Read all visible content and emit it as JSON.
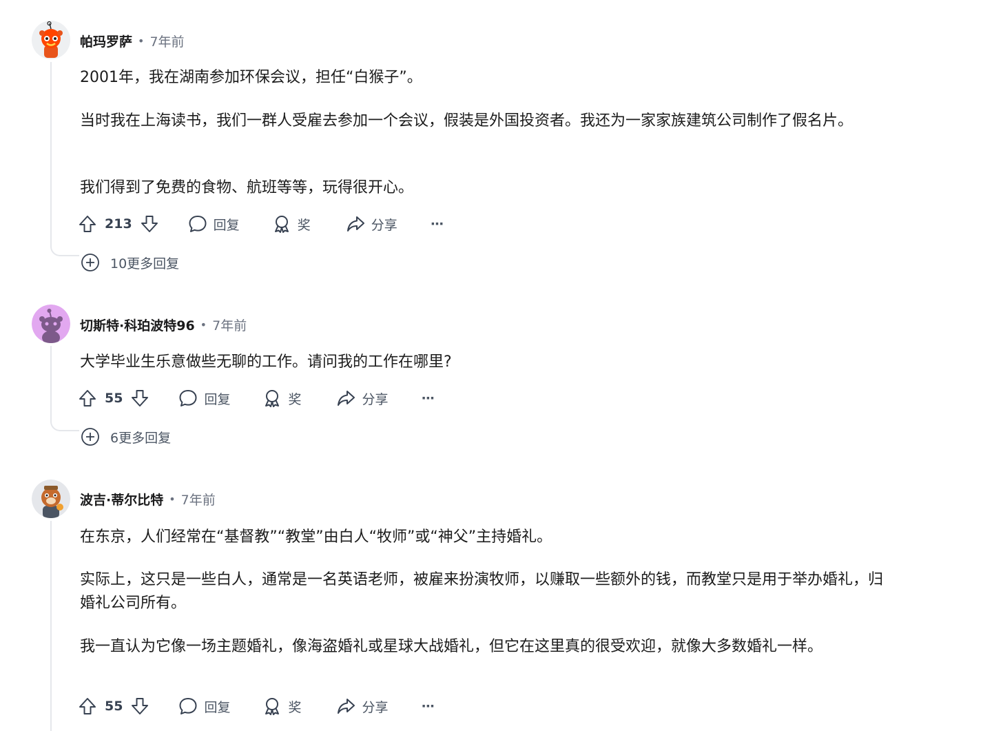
{
  "comments": [
    {
      "username": "帕玛罗萨",
      "time": "7年前",
      "paragraphs": [
        "2001年，我在湖南参加环保会议，担任“白猴子”。",
        "当时我在上海读书，我们一群人受雇去参加一个会议，假装是外国投资者。我还为一家家族建筑公司制作了假名片。",
        "我们得到了免费的食物、航班等等，玩得很开心。"
      ],
      "score": "213",
      "reply_label": "回复",
      "award_label": "奖",
      "share_label": "分享",
      "more_label": "···",
      "more_replies": "10更多回复",
      "avatar_bg": "#ff4500"
    },
    {
      "username": "切斯特·科珀波特96",
      "time": "7年前",
      "paragraphs": [
        "大学毕业生乐意做些无聊的工作。请问我的工作在哪里?"
      ],
      "score": "55",
      "reply_label": "回复",
      "award_label": "奖",
      "share_label": "分享",
      "more_label": "···",
      "more_replies": "6更多回复",
      "avatar_bg": "#e2a8f0"
    },
    {
      "username": "波吉·蒂尔比特",
      "time": "7年前",
      "paragraphs": [
        "在东京，人们经常在“基督教”“教堂”由白人“牧师”或“神父”主持婚礼。",
        "实际上，这只是一些白人，通常是一名英语老师，被雇来扮演牧师，以赚取一些额外的钱，而教堂只是用于举办婚礼，归婚礼公司所有。",
        "我一直认为它像一场主题婚礼，像海盗婚礼或星球大战婚礼，但它在这里真的很受欢迎，就像大多数婚礼一样。"
      ],
      "score": "55",
      "reply_label": "回复",
      "award_label": "奖",
      "share_label": "分享",
      "more_label": "···",
      "avatar_bg": "#c56a2d"
    }
  ]
}
